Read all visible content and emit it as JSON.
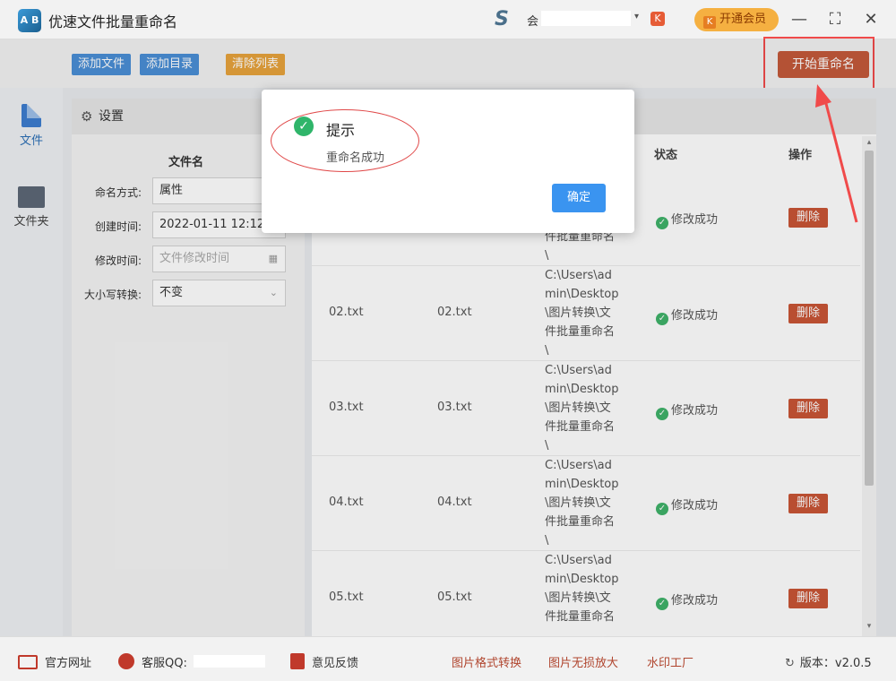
{
  "app": {
    "logo_text": "A B",
    "title": "优速文件批量重命名",
    "user_prefix": "会",
    "vip_label": "开通会员",
    "vip_k": "K",
    "win_controls": [
      "—",
      "⛶",
      "✕"
    ]
  },
  "toolbar": {
    "add_file": "添加文件",
    "add_dir": "添加目录",
    "clear_list": "清除列表",
    "start_rename": "开始重命名"
  },
  "nav": {
    "file": "文件",
    "folder": "文件夹"
  },
  "settings": {
    "header": "设置",
    "section_title": "文件名",
    "fields": [
      {
        "label": "命名方式:",
        "value": "属性",
        "placeholder": false
      },
      {
        "label": "创建时间:",
        "value": "2022-01-11 12:12",
        "placeholder": false
      },
      {
        "label": "修改时间:",
        "value": "文件修改时间",
        "placeholder": true
      },
      {
        "label": "大小写转换:",
        "value": "不变",
        "placeholder": false
      }
    ]
  },
  "table": {
    "headers": {
      "status": "状态",
      "action": "操作"
    },
    "first_row_path_tail": [
      "件批量重命名",
      "\\"
    ],
    "rows": [
      {
        "original": "02.txt",
        "new": "02.txt",
        "path": [
          "C:\\Users\\ad",
          "min\\Desktop",
          "\\图片转换\\文",
          "件批量重命名",
          "\\"
        ],
        "status": "修改成功",
        "action": "删除"
      },
      {
        "original": "03.txt",
        "new": "03.txt",
        "path": [
          "C:\\Users\\ad",
          "min\\Desktop",
          "\\图片转换\\文",
          "件批量重命名",
          "\\"
        ],
        "status": "修改成功",
        "action": "删除"
      },
      {
        "original": "04.txt",
        "new": "04.txt",
        "path": [
          "C:\\Users\\ad",
          "min\\Desktop",
          "\\图片转换\\文",
          "件批量重命名",
          "\\"
        ],
        "status": "修改成功",
        "action": "删除"
      },
      {
        "original": "05.txt",
        "new": "05.txt",
        "path": [
          "C:\\Users\\ad",
          "min\\Desktop",
          "\\图片转换\\文",
          "件批量重命名"
        ],
        "status": "修改成功",
        "action": "删除"
      }
    ],
    "first_row": {
      "status": "修改成功",
      "action": "删除"
    }
  },
  "dialog": {
    "title": "提示",
    "message": "重命名成功",
    "ok": "确定"
  },
  "footer": {
    "website": "官方网址",
    "service_qq": "客服QQ:",
    "feedback": "意见反馈",
    "link1": "图片格式转换",
    "link2": "图片无损放大",
    "link3": "水印工厂",
    "version": "版本：v2.0.5"
  },
  "colors": {
    "primary_blue": "#4a8fd6",
    "orange": "#e8a33c",
    "start_red": "#c45a3a",
    "success_green": "#3fb26a",
    "annotation_red": "#f04a4a"
  }
}
